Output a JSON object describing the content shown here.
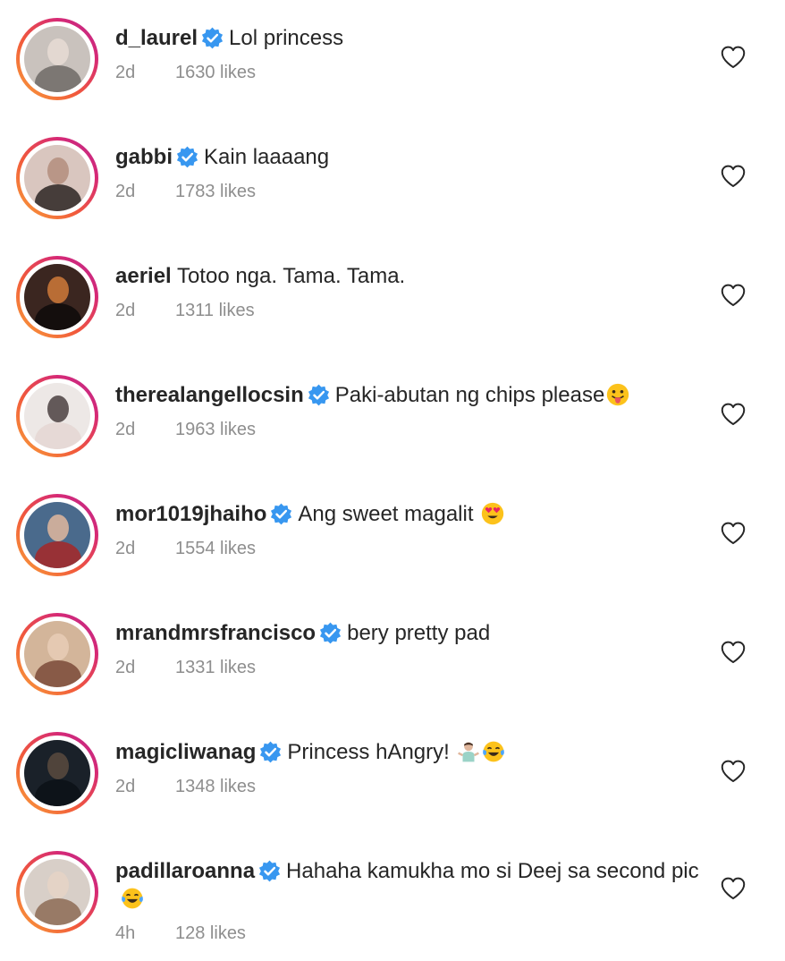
{
  "colors": {
    "username": "#262626",
    "meta": "#8e8e8e",
    "verified": "#3897f0",
    "ring_start": "#f9a23a",
    "ring_end": "#bc2a8d"
  },
  "comments": [
    {
      "username": "d_laurel",
      "verified": true,
      "text": "Lol princess",
      "time": "2d",
      "likes": "1630 likes",
      "emoji": [],
      "avatar_icon": "profile-photo-icon"
    },
    {
      "username": "gabbi",
      "verified": true,
      "text": "Kain laaaang",
      "time": "2d",
      "likes": "1783 likes",
      "emoji": [],
      "avatar_icon": "profile-photo-icon"
    },
    {
      "username": "aeriel",
      "verified": false,
      "text": "Totoo nga. Tama. Tama.",
      "time": "2d",
      "likes": "1311 likes",
      "emoji": [],
      "avatar_icon": "profile-photo-icon"
    },
    {
      "username": "therealangellocsin",
      "verified": true,
      "text": "Paki-abutan ng chips please",
      "time": "2d",
      "likes": "1963 likes",
      "emoji": [
        "tongue-face-emoji"
      ],
      "avatar_icon": "profile-photo-icon"
    },
    {
      "username": "mor1019jhaiho",
      "verified": true,
      "text": "Ang sweet magalit",
      "time": "2d",
      "likes": "1554 likes",
      "emoji": [
        "heart-eyes-emoji"
      ],
      "avatar_icon": "profile-photo-icon"
    },
    {
      "username": "mrandmrsfrancisco",
      "verified": true,
      "text": "bery pretty pad",
      "time": "2d",
      "likes": "1331 likes",
      "emoji": [],
      "avatar_icon": "profile-photo-icon"
    },
    {
      "username": "magicliwanag",
      "verified": true,
      "text": "Princess hAngry!",
      "time": "2d",
      "likes": "1348 likes",
      "emoji": [
        "man-shrugging-emoji",
        "tears-of-joy-emoji"
      ],
      "avatar_icon": "profile-photo-icon"
    },
    {
      "username": "padillaroanna",
      "verified": true,
      "text": "Hahaha kamukha mo si Deej sa second pic",
      "time": "4h",
      "likes": "128 likes",
      "emoji": [
        "tears-of-joy-emoji"
      ],
      "avatar_icon": "profile-photo-icon"
    }
  ],
  "icons": {
    "like": "heart-outline-icon",
    "verified": "verified-badge-icon"
  }
}
